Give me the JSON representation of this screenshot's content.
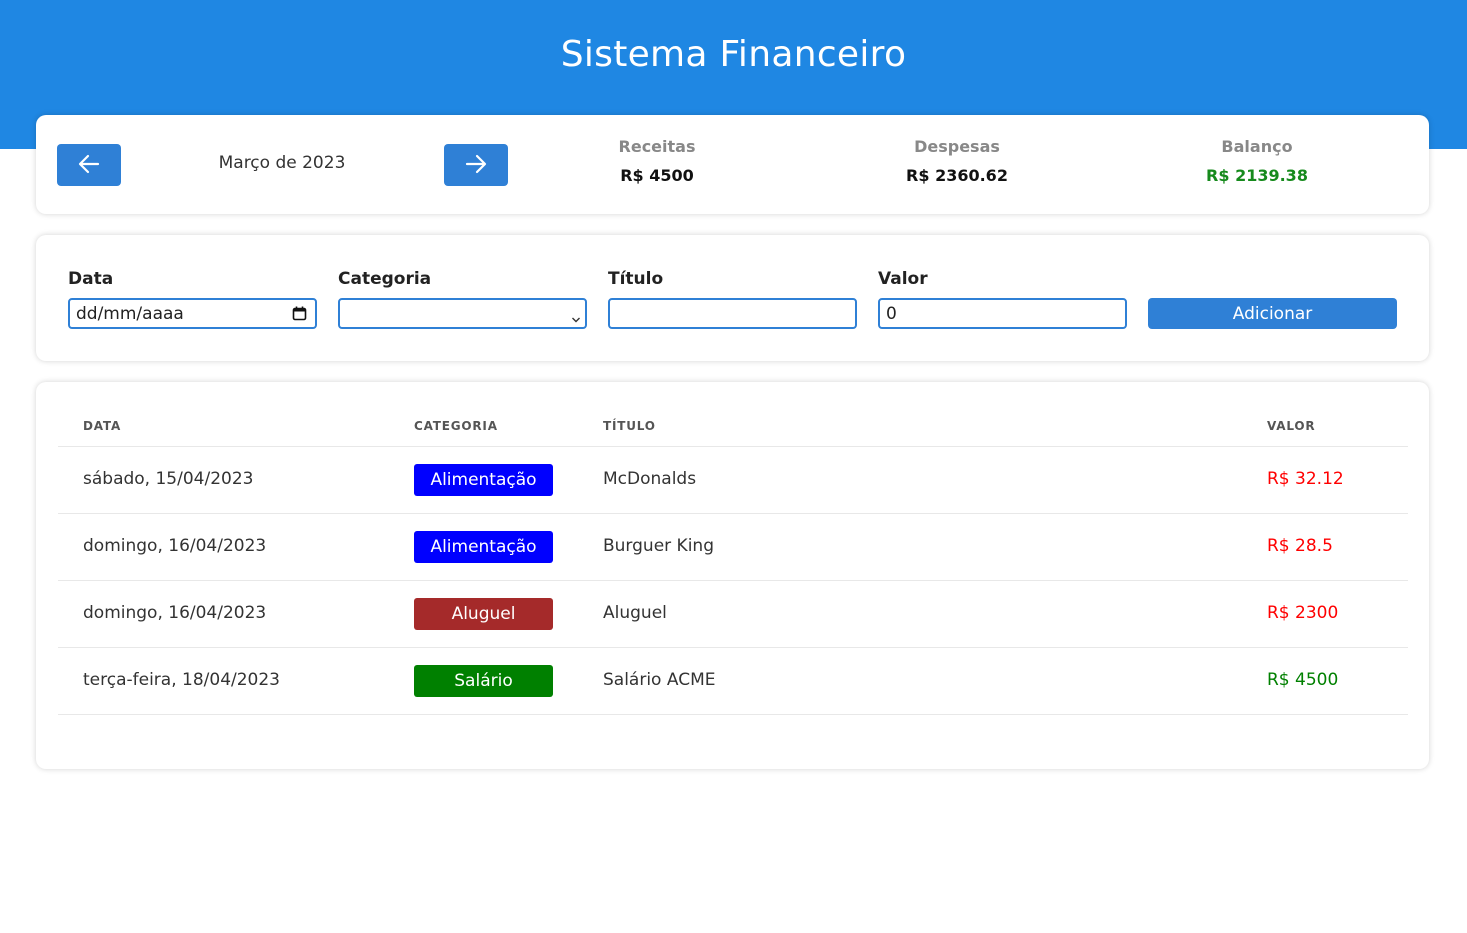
{
  "app": {
    "title": "Sistema Financeiro"
  },
  "summary": {
    "month": "Março de 2023",
    "receitas_label": "Receitas",
    "receitas_value": "R$ 4500",
    "despesas_label": "Despesas",
    "despesas_value": "R$ 2360.62",
    "balanco_label": "Balanço",
    "balanco_value": "R$ 2139.38",
    "balanco_color": "#168a1c"
  },
  "form": {
    "data_label": "Data",
    "data_placeholder": "dd/mm/aaaa",
    "categoria_label": "Categoria",
    "categoria_value": "",
    "titulo_label": "Título",
    "titulo_value": "",
    "valor_label": "Valor",
    "valor_value": "0",
    "add_label": "Adicionar"
  },
  "table": {
    "headers": {
      "data": "DATA",
      "categoria": "CATEGORIA",
      "titulo": "TÍTULO",
      "valor": "VALOR"
    },
    "rows": [
      {
        "data": "sábado, 15/04/2023",
        "categoria": "Alimentação",
        "categoria_color": "#0000ff",
        "titulo": "McDonalds",
        "valor": "R$ 32.12",
        "valor_color": "#ff0000"
      },
      {
        "data": "domingo, 16/04/2023",
        "categoria": "Alimentação",
        "categoria_color": "#0000ff",
        "titulo": "Burguer King",
        "valor": "R$ 28.5",
        "valor_color": "#ff0000"
      },
      {
        "data": "domingo, 16/04/2023",
        "categoria": "Aluguel",
        "categoria_color": "#a52a2a",
        "titulo": "Aluguel",
        "valor": "R$ 2300",
        "valor_color": "#ff0000"
      },
      {
        "data": "terça-feira, 18/04/2023",
        "categoria": "Salário",
        "categoria_color": "#008000",
        "titulo": "Salário ACME",
        "valor": "R$ 4500",
        "valor_color": "#008000"
      }
    ]
  },
  "colors": {
    "header": "#1f87e3",
    "primary": "#2f80d6"
  },
  "icons": {
    "prev": "arrow-left-icon",
    "next": "arrow-right-icon",
    "calendar": "calendar-icon",
    "dropdown": "chevron-down-icon"
  }
}
